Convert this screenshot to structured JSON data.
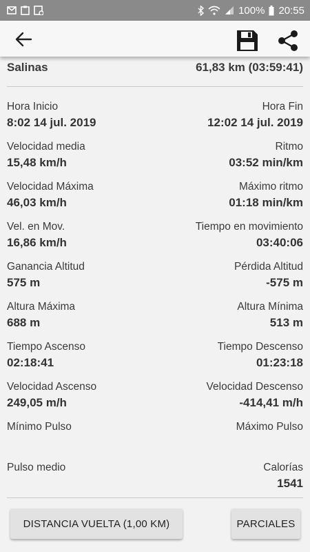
{
  "status_bar": {
    "battery": "100%",
    "time": "20:55",
    "icons": [
      "mail-icon",
      "clipboard-icon",
      "image-icon",
      "bluetooth-icon",
      "wifi-icon",
      "signal-icon",
      "battery-icon"
    ]
  },
  "app_bar": {
    "icons": [
      "back-arrow-icon",
      "save-icon",
      "share-icon"
    ]
  },
  "summary": {
    "name": "Salinas",
    "distance_time": "61,83 km (03:59:41)"
  },
  "stats": [
    {
      "left_label": "Hora Inicio",
      "left_value": "8:02 14 jul. 2019",
      "right_label": "Hora Fin",
      "right_value": "12:02 14 jul. 2019"
    },
    {
      "left_label": "Velocidad media",
      "left_value": "15,48 km/h",
      "right_label": "Ritmo",
      "right_value": "03:52 min/km"
    },
    {
      "left_label": "Velocidad Máxima",
      "left_value": "46,03 km/h",
      "right_label": "Máximo ritmo",
      "right_value": "01:18 min/km"
    },
    {
      "left_label": "Vel. en Mov.",
      "left_value": "16,86 km/h",
      "right_label": "Tiempo en movimiento",
      "right_value": "03:40:06"
    },
    {
      "left_label": "Ganancia Altitud",
      "left_value": "575 m",
      "right_label": "Pérdida Altitud",
      "right_value": "-575 m"
    },
    {
      "left_label": "Altura Máxima",
      "left_value": "688 m",
      "right_label": "Altura Mínima",
      "right_value": "513 m"
    },
    {
      "left_label": "Tiempo Ascenso",
      "left_value": "02:18:41",
      "right_label": "Tiempo Descenso",
      "right_value": "01:23:18"
    },
    {
      "left_label": "Velocidad Ascenso",
      "left_value": "249,05 m/h",
      "right_label": "Velocidad Descenso",
      "right_value": "-414,41 m/h"
    },
    {
      "left_label": "Mínimo Pulso",
      "left_value": "",
      "right_label": "Máximo Pulso",
      "right_value": ""
    },
    {
      "left_label": "Pulso medio",
      "left_value": "",
      "right_label": "Calorías",
      "right_value": "1541"
    }
  ],
  "buttons": {
    "lap_distance": "DISTANCIA VUELTA (1,00  KM)",
    "splits": "PARCIALES"
  }
}
